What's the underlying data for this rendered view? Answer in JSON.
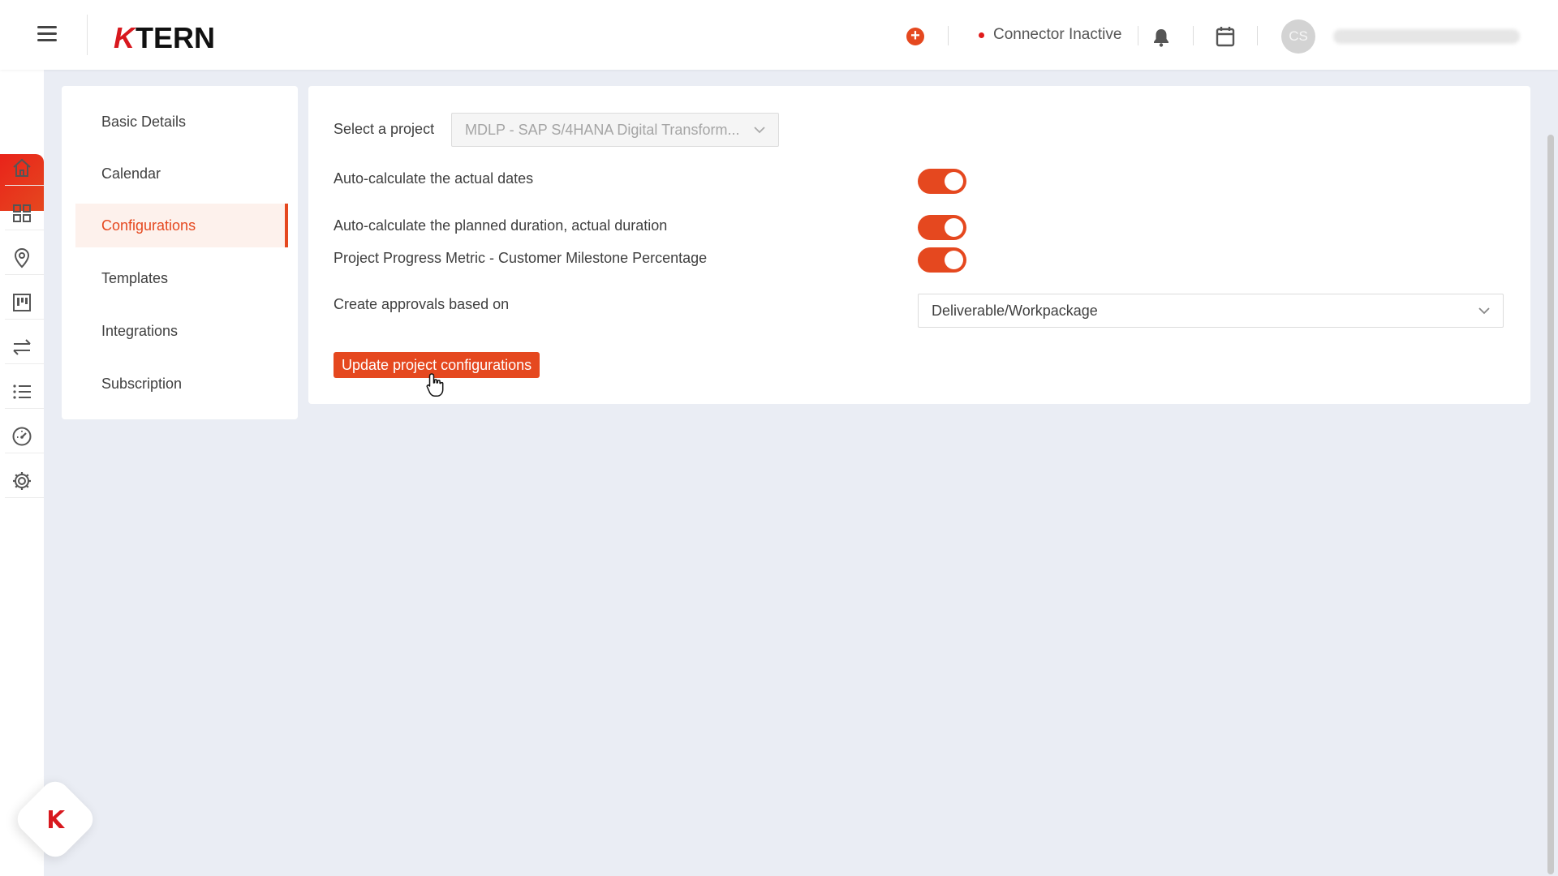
{
  "header": {
    "logo_k": "K",
    "logo_rest": "TERN",
    "add_icon": "plus-circle-icon",
    "connector_status": "Connector Inactive",
    "avatar_initials": "CS"
  },
  "rail": {
    "icons": [
      "home-icon",
      "dashboard-grid-icon",
      "location-pin-icon",
      "board-icon",
      "transfer-arrows-icon",
      "list-icon",
      "gauge-icon",
      "settings-gear-icon"
    ]
  },
  "settings_nav": {
    "items": [
      {
        "label": "Basic Details"
      },
      {
        "label": "Calendar"
      },
      {
        "label": "Configurations",
        "active": true
      },
      {
        "label": "Templates"
      },
      {
        "label": "Integrations"
      },
      {
        "label": "Subscription"
      }
    ]
  },
  "config": {
    "select_project_label": "Select a project",
    "selected_project": "MDLP - SAP S/4HANA Digital Transform...",
    "toggles": [
      {
        "label": "Auto-calculate the actual dates",
        "on": true
      },
      {
        "label": "Auto-calculate the planned duration, actual duration",
        "on": true
      },
      {
        "label": "Project Progress Metric - Customer Milestone Percentage",
        "on": true
      }
    ],
    "approvals_label": "Create approvals based on",
    "approvals_value": "Deliverable/Workpackage",
    "update_button": "Update project configurations"
  },
  "colors": {
    "accent": "#e5481f",
    "brand_red": "#d8181e",
    "background": "#eaedf4"
  }
}
